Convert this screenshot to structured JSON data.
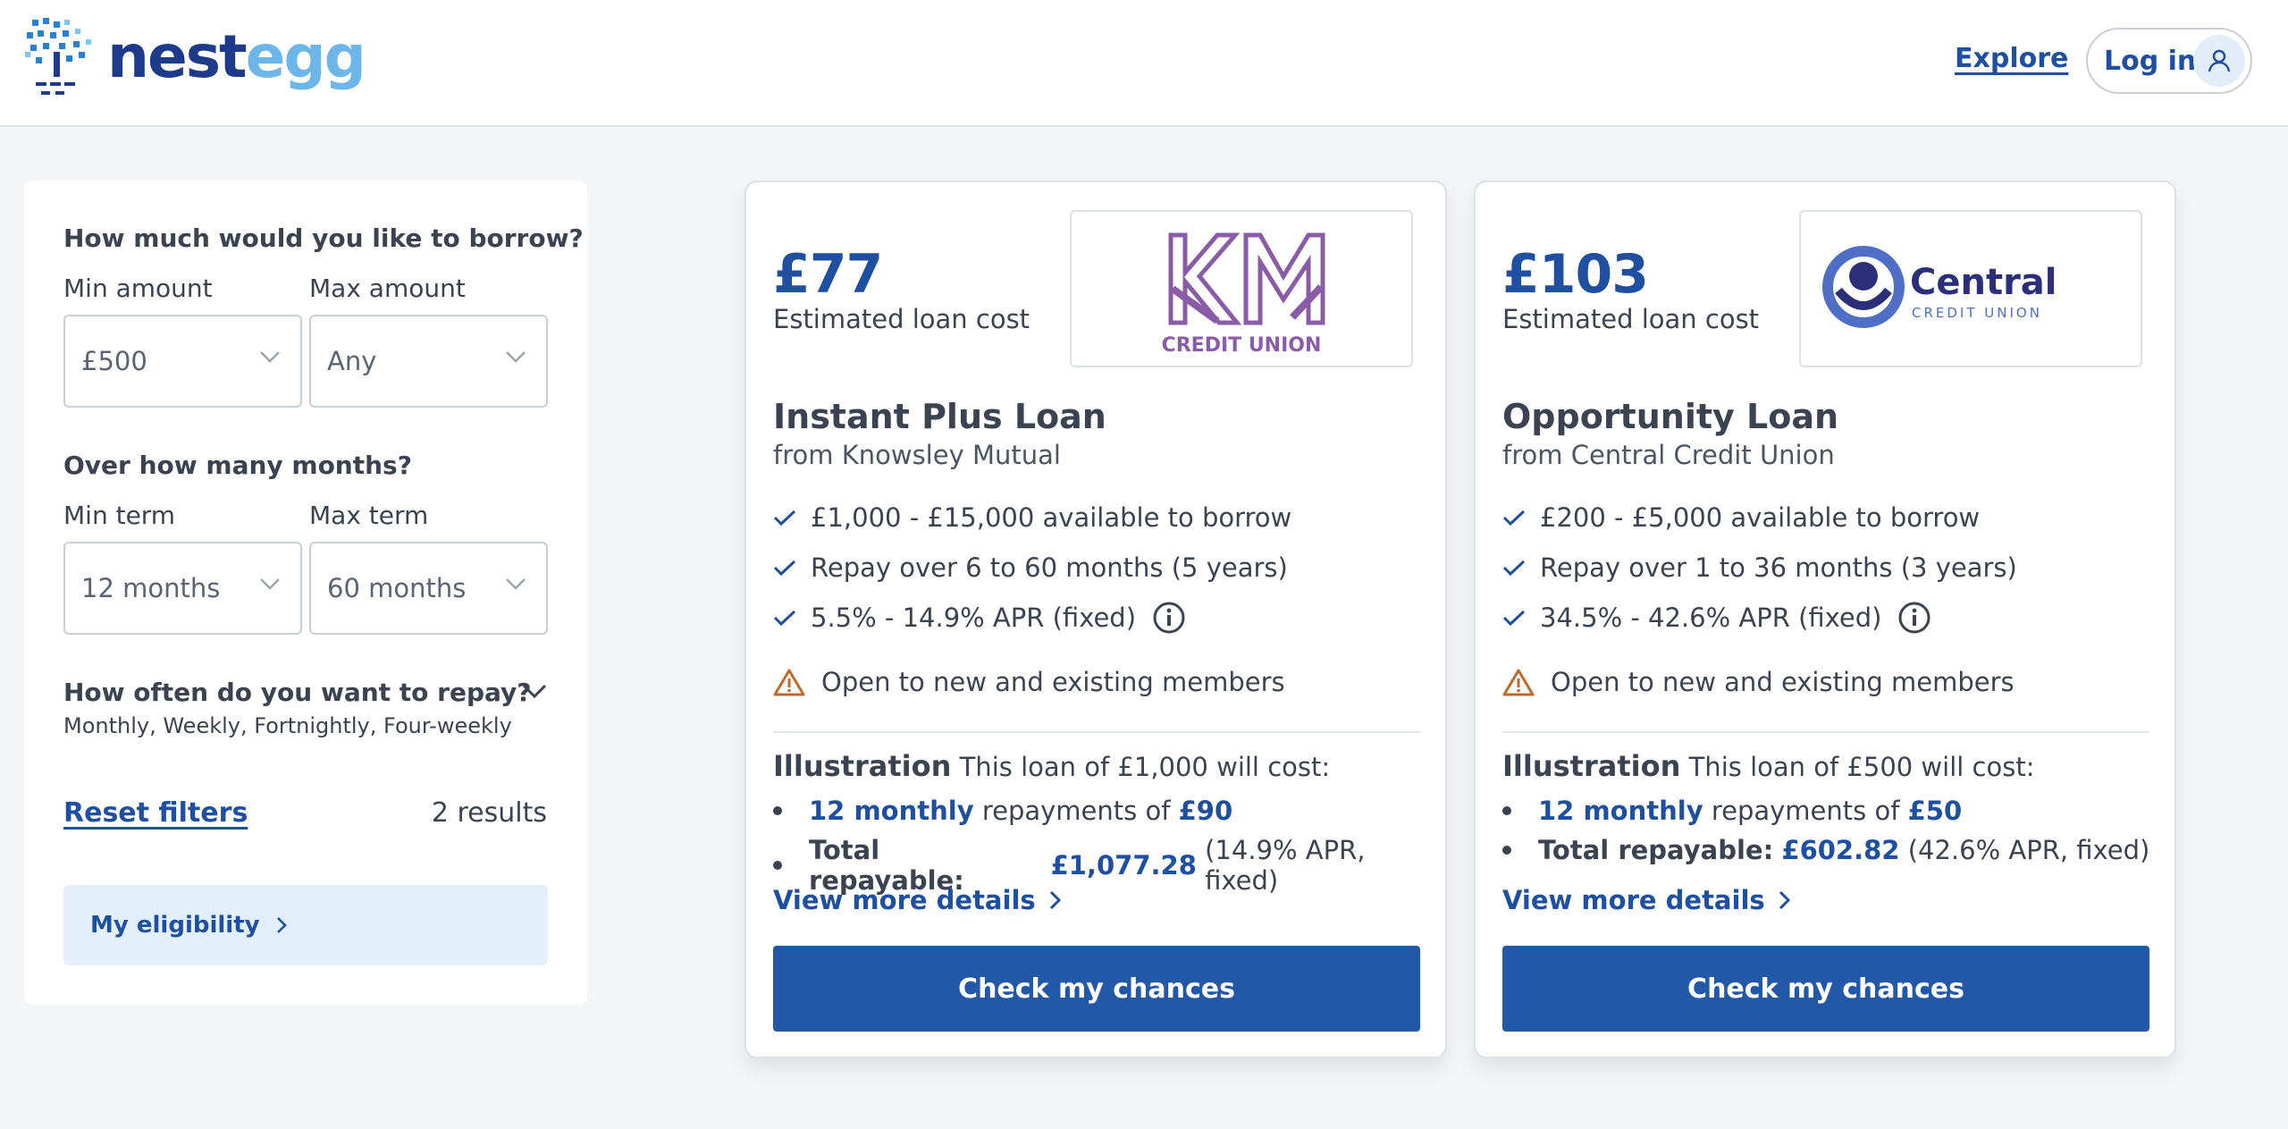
{
  "header": {
    "brand_part1": "nest",
    "brand_part2": "egg",
    "explore": "Explore",
    "login": "Log in"
  },
  "filters": {
    "borrow_question": "How much would you like to borrow?",
    "min_amount_label": "Min amount",
    "max_amount_label": "Max amount",
    "min_amount_value": "£500",
    "max_amount_value": "Any",
    "months_question": "Over how many months?",
    "min_term_label": "Min term",
    "max_term_label": "Max term",
    "min_term_value": "12 months",
    "max_term_value": "60 months",
    "repay_question": "How often do you want to repay?",
    "repay_options": "Monthly, Weekly, Fortnightly, Four-weekly",
    "reset": "Reset filters",
    "results": "2 results",
    "eligibility": "My eligibility"
  },
  "cards": [
    {
      "price": "£77",
      "price_label": "Estimated loan cost",
      "logo_text": "CREDIT UNION",
      "name": "Instant Plus Loan",
      "provider": "from Knowsley Mutual",
      "features": [
        "£1,000 - £15,000 available to borrow",
        "Repay over 6 to 60 months (5 years)",
        "5.5% - 14.9% APR (fixed)"
      ],
      "warning": "Open to new and existing members",
      "illus_title": "Illustration",
      "illus_text": "This loan of £1,000 will cost:",
      "rep_freq": "12 monthly",
      "rep_mid": "repayments of",
      "rep_amount": "£90",
      "total_label": "Total repayable:",
      "total_value": "£1,077.28",
      "total_note": "(14.9% APR, fixed)",
      "more": "View more details",
      "cta": "Check my chances"
    },
    {
      "price": "£103",
      "price_label": "Estimated loan cost",
      "logo_text": "Central",
      "logo_sub": "CREDIT UNION",
      "name": "Opportunity Loan",
      "provider": "from Central Credit Union",
      "features": [
        "£200 - £5,000 available to borrow",
        "Repay over 1 to 36 months (3 years)",
        "34.5% - 42.6% APR (fixed)"
      ],
      "warning": "Open to new and existing members",
      "illus_title": "Illustration",
      "illus_text": "This loan of £500 will cost:",
      "rep_freq": "12 monthly",
      "rep_mid": "repayments of",
      "rep_amount": "£50",
      "total_label": "Total repayable:",
      "total_value": "£602.82",
      "total_note": "(42.6% APR, fixed)",
      "more": "View more details",
      "cta": "Check my chances"
    }
  ],
  "colors": {
    "brand_dark": "#1e3a8a",
    "brand_light": "#6cb6ea",
    "accent": "#2357a8",
    "warning": "#c0692b",
    "km_purple": "#8a5ca8"
  }
}
